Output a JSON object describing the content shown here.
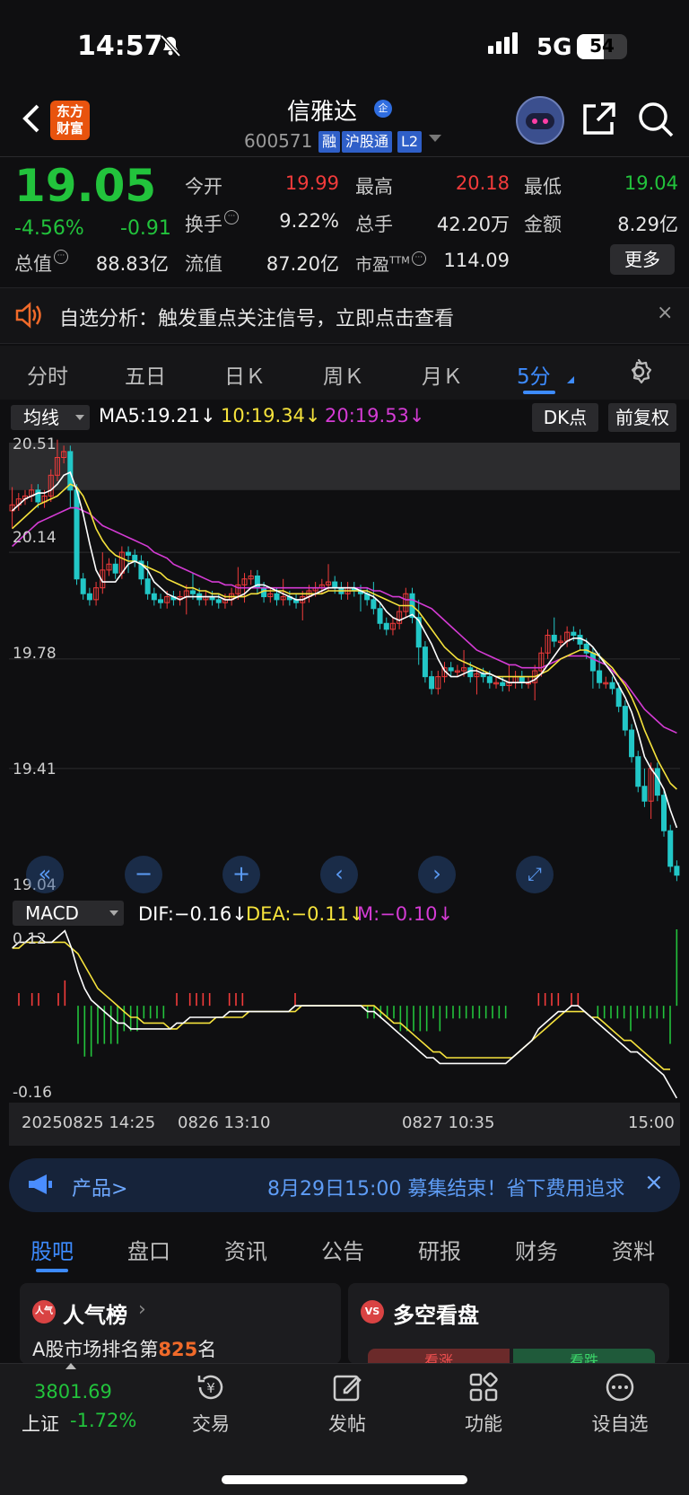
{
  "status": {
    "time": "14:57",
    "network": "5G",
    "battery": "54",
    "battery_level": 54
  },
  "header": {
    "name": "信雅达",
    "name_badge": "企",
    "code": "600571",
    "tags": [
      "融",
      "沪股通",
      "L2"
    ],
    "logo": [
      "东方",
      "财富"
    ]
  },
  "quote": {
    "price": "19.05",
    "change_pct": "-4.56%",
    "change": "-0.91",
    "labels": {
      "open": "今开",
      "high": "最高",
      "low": "最低",
      "turnover": "换手",
      "volume": "总手",
      "amount": "金额",
      "total_mv": "总值",
      "float_mv": "流值",
      "pe": "市盈",
      "pe_sup": "TTM"
    },
    "open": "19.99",
    "high": "20.18",
    "low": "19.04",
    "turnover": "9.22%",
    "volume": "42.20万",
    "amount": "8.29亿",
    "total_mv": "88.83亿",
    "float_mv": "87.20亿",
    "pe": "114.09",
    "more": "更多"
  },
  "notice": {
    "text": "自选分析：触发重点关注信号，立即点击查看",
    "close": "×"
  },
  "period_tabs": [
    "分时",
    "五日",
    "日Ｋ",
    "周Ｋ",
    "月Ｋ",
    "5分"
  ],
  "active_period": 5,
  "legend": {
    "selector": "均线",
    "ma5": "MA5:19.21",
    "ma10": "10:19.34",
    "ma20": "20:19.53",
    "down": "↓",
    "dk": "DK点",
    "fq": "前复权"
  },
  "macd_legend": {
    "selector": "MACD",
    "dif": "DIF:−0.16",
    "dea": "DEA:−0.11",
    "m": "M:−0.10",
    "down": "↓"
  },
  "axis": {
    "x_labels": [
      "20250825 14:25",
      "0826 13:10",
      "0827 10:35",
      "15:00"
    ]
  },
  "colors": {
    "up": "#f23b3b",
    "down": "#22c7c7",
    "ma5": "#ffffff",
    "ma10": "#f5e23c",
    "ma20": "#d43bd4",
    "macd_up": "#f23b3b",
    "macd_down": "#22c33c"
  },
  "chart_data": [
    {
      "type": "candlestick",
      "title": "",
      "y_ticks": [
        "20.51",
        "20.14",
        "19.78",
        "19.41",
        "19.04"
      ],
      "ylim": [
        19.04,
        20.51
      ],
      "series": [
        {
          "name": "MA5",
          "last": 19.21
        },
        {
          "name": "10",
          "last": 19.34
        },
        {
          "name": "20",
          "last": 19.53
        }
      ],
      "close": [
        20.3,
        20.32,
        20.33,
        20.35,
        20.31,
        20.33,
        20.4,
        20.46,
        20.48,
        20.35,
        20.05,
        20.0,
        19.98,
        20.02,
        20.08,
        20.1,
        20.07,
        20.14,
        20.13,
        20.11,
        20.05,
        20.0,
        19.98,
        19.97,
        19.99,
        19.98,
        19.99,
        20.01,
        20.0,
        19.98,
        19.99,
        19.98,
        19.97,
        19.98,
        20.0,
        20.03,
        20.05,
        20.06,
        20.02,
        19.99,
        20.0,
        19.98,
        19.99,
        19.98,
        19.97,
        19.99,
        20.01,
        20.02,
        20.03,
        20.04,
        20.02,
        20.0,
        20.02,
        20.01,
        20.0,
        19.98,
        19.95,
        19.9,
        19.88,
        19.9,
        19.94,
        20.0,
        19.92,
        19.82,
        19.72,
        19.68,
        19.72,
        19.75,
        19.74,
        19.74,
        19.75,
        19.72,
        19.73,
        19.72,
        19.7,
        19.7,
        19.69,
        19.7,
        19.72,
        19.7,
        19.7,
        19.74,
        19.8,
        19.86,
        19.84,
        19.84,
        19.87,
        19.86,
        19.83,
        19.8,
        19.74,
        19.7,
        19.7,
        19.68,
        19.62,
        19.54,
        19.45,
        19.35,
        19.3,
        19.41,
        19.32,
        19.2,
        19.08,
        19.05
      ],
      "ma5": [
        20.28,
        20.3,
        20.32,
        20.33,
        20.34,
        20.34,
        20.35,
        20.37,
        20.4,
        20.41,
        20.35,
        20.27,
        20.17,
        20.08,
        20.04,
        20.04,
        20.04,
        20.07,
        20.1,
        20.11,
        20.1,
        20.08,
        20.04,
        20.02,
        20.0,
        19.99,
        19.98,
        19.99,
        19.99,
        19.99,
        19.99,
        19.99,
        19.99,
        19.98,
        19.98,
        19.99,
        20.0,
        20.02,
        20.03,
        20.03,
        20.02,
        20.01,
        20.0,
        19.99,
        19.98,
        19.98,
        19.99,
        20.0,
        20.01,
        20.02,
        20.02,
        20.02,
        20.02,
        20.02,
        20.01,
        20.0,
        19.99,
        19.97,
        19.94,
        19.92,
        19.91,
        19.92,
        19.93,
        19.91,
        19.87,
        19.83,
        19.78,
        19.74,
        19.72,
        19.72,
        19.73,
        19.74,
        19.74,
        19.73,
        19.73,
        19.72,
        19.71,
        19.7,
        19.7,
        19.7,
        19.7,
        19.71,
        19.73,
        19.76,
        19.79,
        19.82,
        19.84,
        19.85,
        19.85,
        19.84,
        19.82,
        19.79,
        19.76,
        19.73,
        19.69,
        19.65,
        19.6,
        19.53,
        19.45,
        19.41,
        19.38,
        19.34,
        19.27,
        19.21
      ],
      "ma10": [
        20.22,
        20.24,
        20.26,
        20.28,
        20.3,
        20.31,
        20.32,
        20.33,
        20.35,
        20.37,
        20.36,
        20.33,
        20.28,
        20.22,
        20.18,
        20.15,
        20.13,
        20.12,
        20.11,
        20.11,
        20.1,
        20.09,
        20.08,
        20.07,
        20.05,
        20.04,
        20.03,
        20.02,
        20.02,
        20.01,
        20.01,
        20.0,
        20.0,
        19.99,
        19.99,
        19.99,
        19.99,
        20.0,
        20.0,
        20.01,
        20.01,
        20.01,
        20.01,
        20.0,
        20.0,
        20.0,
        20.0,
        20.0,
        20.0,
        20.01,
        20.01,
        20.01,
        20.01,
        20.01,
        20.01,
        20.01,
        20.0,
        19.99,
        19.98,
        19.97,
        19.96,
        19.96,
        19.96,
        19.94,
        19.91,
        19.88,
        19.85,
        19.82,
        19.8,
        19.78,
        19.77,
        19.76,
        19.75,
        19.74,
        19.73,
        19.72,
        19.72,
        19.72,
        19.72,
        19.72,
        19.72,
        19.72,
        19.73,
        19.74,
        19.76,
        19.78,
        19.79,
        19.8,
        19.81,
        19.81,
        19.8,
        19.79,
        19.77,
        19.75,
        19.72,
        19.69,
        19.65,
        19.6,
        19.54,
        19.49,
        19.44,
        19.4,
        19.36,
        19.34
      ],
      "ma20": [
        20.16,
        20.18,
        20.2,
        20.22,
        20.24,
        20.25,
        20.26,
        20.27,
        20.28,
        20.29,
        20.29,
        20.28,
        20.27,
        20.25,
        20.23,
        20.22,
        20.21,
        20.2,
        20.19,
        20.18,
        20.17,
        20.16,
        20.14,
        20.13,
        20.12,
        20.1,
        20.09,
        20.08,
        20.07,
        20.06,
        20.05,
        20.04,
        20.04,
        20.03,
        20.03,
        20.02,
        20.02,
        20.02,
        20.02,
        20.02,
        20.02,
        20.02,
        20.02,
        20.02,
        20.02,
        20.02,
        20.02,
        20.02,
        20.02,
        20.02,
        20.02,
        20.02,
        20.02,
        20.02,
        20.02,
        20.02,
        20.01,
        20.01,
        20.0,
        19.99,
        19.99,
        19.98,
        19.98,
        19.97,
        19.96,
        19.95,
        19.93,
        19.91,
        19.89,
        19.87,
        19.85,
        19.83,
        19.81,
        19.8,
        19.79,
        19.78,
        19.77,
        19.76,
        19.76,
        19.75,
        19.75,
        19.75,
        19.75,
        19.76,
        19.77,
        19.78,
        19.79,
        19.79,
        19.79,
        19.79,
        19.78,
        19.77,
        19.76,
        19.74,
        19.72,
        19.7,
        19.67,
        19.64,
        19.61,
        19.59,
        19.57,
        19.55,
        19.54,
        19.53
      ]
    },
    {
      "type": "bar",
      "title": "MACD",
      "y_ticks": [
        "0.12",
        "-0.16"
      ],
      "ylim": [
        -0.16,
        0.12
      ],
      "series": [
        {
          "name": "DIF",
          "last": -0.16
        },
        {
          "name": "DEA",
          "last": -0.11
        },
        {
          "name": "M",
          "last": -0.1
        }
      ],
      "dif": [
        0.1,
        0.11,
        0.11,
        0.12,
        0.12,
        0.11,
        0.11,
        0.12,
        0.13,
        0.1,
        0.06,
        0.03,
        0.01,
        0.0,
        -0.01,
        -0.02,
        -0.03,
        -0.03,
        -0.04,
        -0.04,
        -0.04,
        -0.04,
        -0.04,
        -0.04,
        -0.04,
        -0.03,
        -0.03,
        -0.02,
        -0.02,
        -0.02,
        -0.02,
        -0.02,
        -0.02,
        -0.01,
        -0.01,
        -0.01,
        -0.01,
        -0.01,
        -0.01,
        -0.01,
        -0.01,
        -0.01,
        -0.01,
        0.0,
        0.0,
        0.0,
        0.0,
        0.0,
        0.0,
        0.0,
        0.0,
        0.0,
        0.0,
        0.0,
        -0.01,
        -0.01,
        -0.02,
        -0.03,
        -0.04,
        -0.05,
        -0.06,
        -0.07,
        -0.08,
        -0.09,
        -0.09,
        -0.1,
        -0.1,
        -0.1,
        -0.1,
        -0.1,
        -0.1,
        -0.1,
        -0.1,
        -0.1,
        -0.1,
        -0.1,
        -0.09,
        -0.08,
        -0.07,
        -0.06,
        -0.04,
        -0.03,
        -0.02,
        -0.01,
        -0.01,
        0.0,
        0.0,
        -0.01,
        -0.02,
        -0.03,
        -0.04,
        -0.05,
        -0.06,
        -0.07,
        -0.08,
        -0.08,
        -0.09,
        -0.1,
        -0.11,
        -0.12,
        -0.14,
        -0.16
      ],
      "dea": [
        0.1,
        0.1,
        0.11,
        0.11,
        0.11,
        0.11,
        0.11,
        0.11,
        0.11,
        0.1,
        0.09,
        0.07,
        0.05,
        0.03,
        0.02,
        0.01,
        0.0,
        -0.01,
        -0.02,
        -0.02,
        -0.03,
        -0.03,
        -0.03,
        -0.03,
        -0.04,
        -0.04,
        -0.03,
        -0.03,
        -0.03,
        -0.03,
        -0.03,
        -0.02,
        -0.02,
        -0.02,
        -0.02,
        -0.02,
        -0.01,
        -0.01,
        -0.01,
        -0.01,
        -0.01,
        -0.01,
        -0.01,
        -0.01,
        0.0,
        0.0,
        0.0,
        0.0,
        0.0,
        0.0,
        0.0,
        0.0,
        0.0,
        0.0,
        0.0,
        0.0,
        -0.01,
        -0.02,
        -0.03,
        -0.03,
        -0.04,
        -0.05,
        -0.06,
        -0.07,
        -0.08,
        -0.08,
        -0.09,
        -0.09,
        -0.09,
        -0.09,
        -0.09,
        -0.09,
        -0.09,
        -0.09,
        -0.09,
        -0.09,
        -0.09,
        -0.08,
        -0.07,
        -0.06,
        -0.05,
        -0.04,
        -0.03,
        -0.02,
        -0.01,
        -0.01,
        -0.01,
        -0.01,
        -0.02,
        -0.02,
        -0.03,
        -0.04,
        -0.05,
        -0.06,
        -0.06,
        -0.07,
        -0.08,
        -0.09,
        -0.1,
        -0.11,
        -0.11
      ]
    }
  ],
  "ad": {
    "label": "产品>",
    "text": "8月29日15:00 募集结束！省下费用追求",
    "close": "×"
  },
  "bottom_tabs": [
    "股吧",
    "盘口",
    "资讯",
    "公告",
    "研报",
    "财务",
    "资料"
  ],
  "cards": {
    "left": {
      "icon": "人气",
      "title": "人气榜",
      "sub_pre": "A股市场排名第",
      "rank": "825",
      "sub_post": "名"
    },
    "right": {
      "icon": "VS",
      "title": "多空看盘",
      "up": "看涨",
      "down": "看跌"
    }
  },
  "nav": {
    "index_value": "3801.69",
    "index_name": "上证",
    "index_chg": "-1.72%",
    "items": [
      "交易",
      "发帖",
      "功能",
      "设自选"
    ]
  }
}
